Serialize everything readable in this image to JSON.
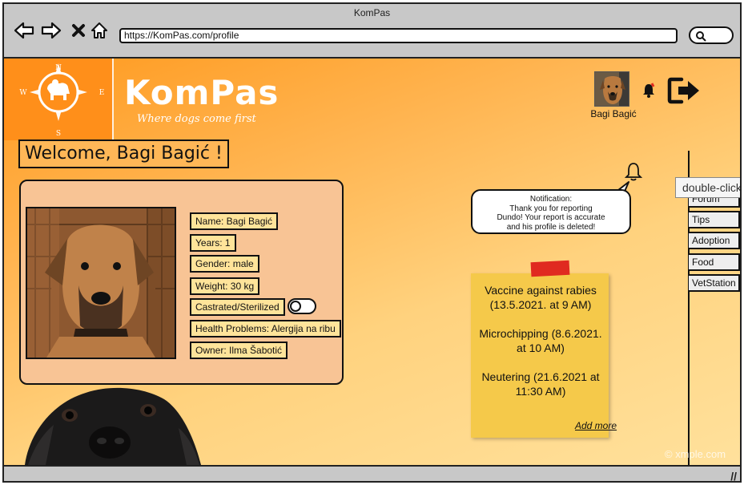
{
  "browser": {
    "window_title": "KomPas",
    "url": "https://KomPas.com/profile",
    "icons": [
      "back-arrow-icon",
      "forward-arrow-icon",
      "close-icon",
      "home-icon",
      "search-icon"
    ]
  },
  "header": {
    "brand": "KomPas",
    "tagline": "Where dogs come first",
    "compass_letters": {
      "n": "N",
      "s": "S",
      "e": "E",
      "w": "W"
    },
    "user_name": "Bagi Bagić"
  },
  "welcome": "Welcome, Bagi Bagić !",
  "profile": {
    "fields": [
      "Name: Bagi Bagić",
      "Years: 1",
      "Gender: male",
      "Weight: 30 kg",
      "Castrated/Sterilized",
      "Health Problems: Alergija na ribu",
      "Owner: Ilma Šabotić"
    ],
    "castrated_toggle": false
  },
  "notification": {
    "lines": [
      "Notification:",
      "Thank you for reporting",
      "Dundo! Your report is accurate",
      "and his profile is deleted!"
    ]
  },
  "sticky_note": {
    "items": [
      "Vaccine against rabies (13.5.2021. at 9 AM)",
      "Microchipping (8.6.2021. at 10 AM)",
      "Neutering (21.6.2021 at 11:30 AM)"
    ],
    "add_more": "Add more"
  },
  "side_tabs": [
    "Forum",
    "Tips",
    "Adoption",
    "Food",
    "VetStation"
  ],
  "tooltip": "double-click",
  "watermark": "© xmple.com",
  "colors": {
    "accent": "#ff8f1a",
    "note": "#f5c94a",
    "tape": "#e02a20",
    "card": "#f8c495",
    "field": "#ffe49a"
  }
}
